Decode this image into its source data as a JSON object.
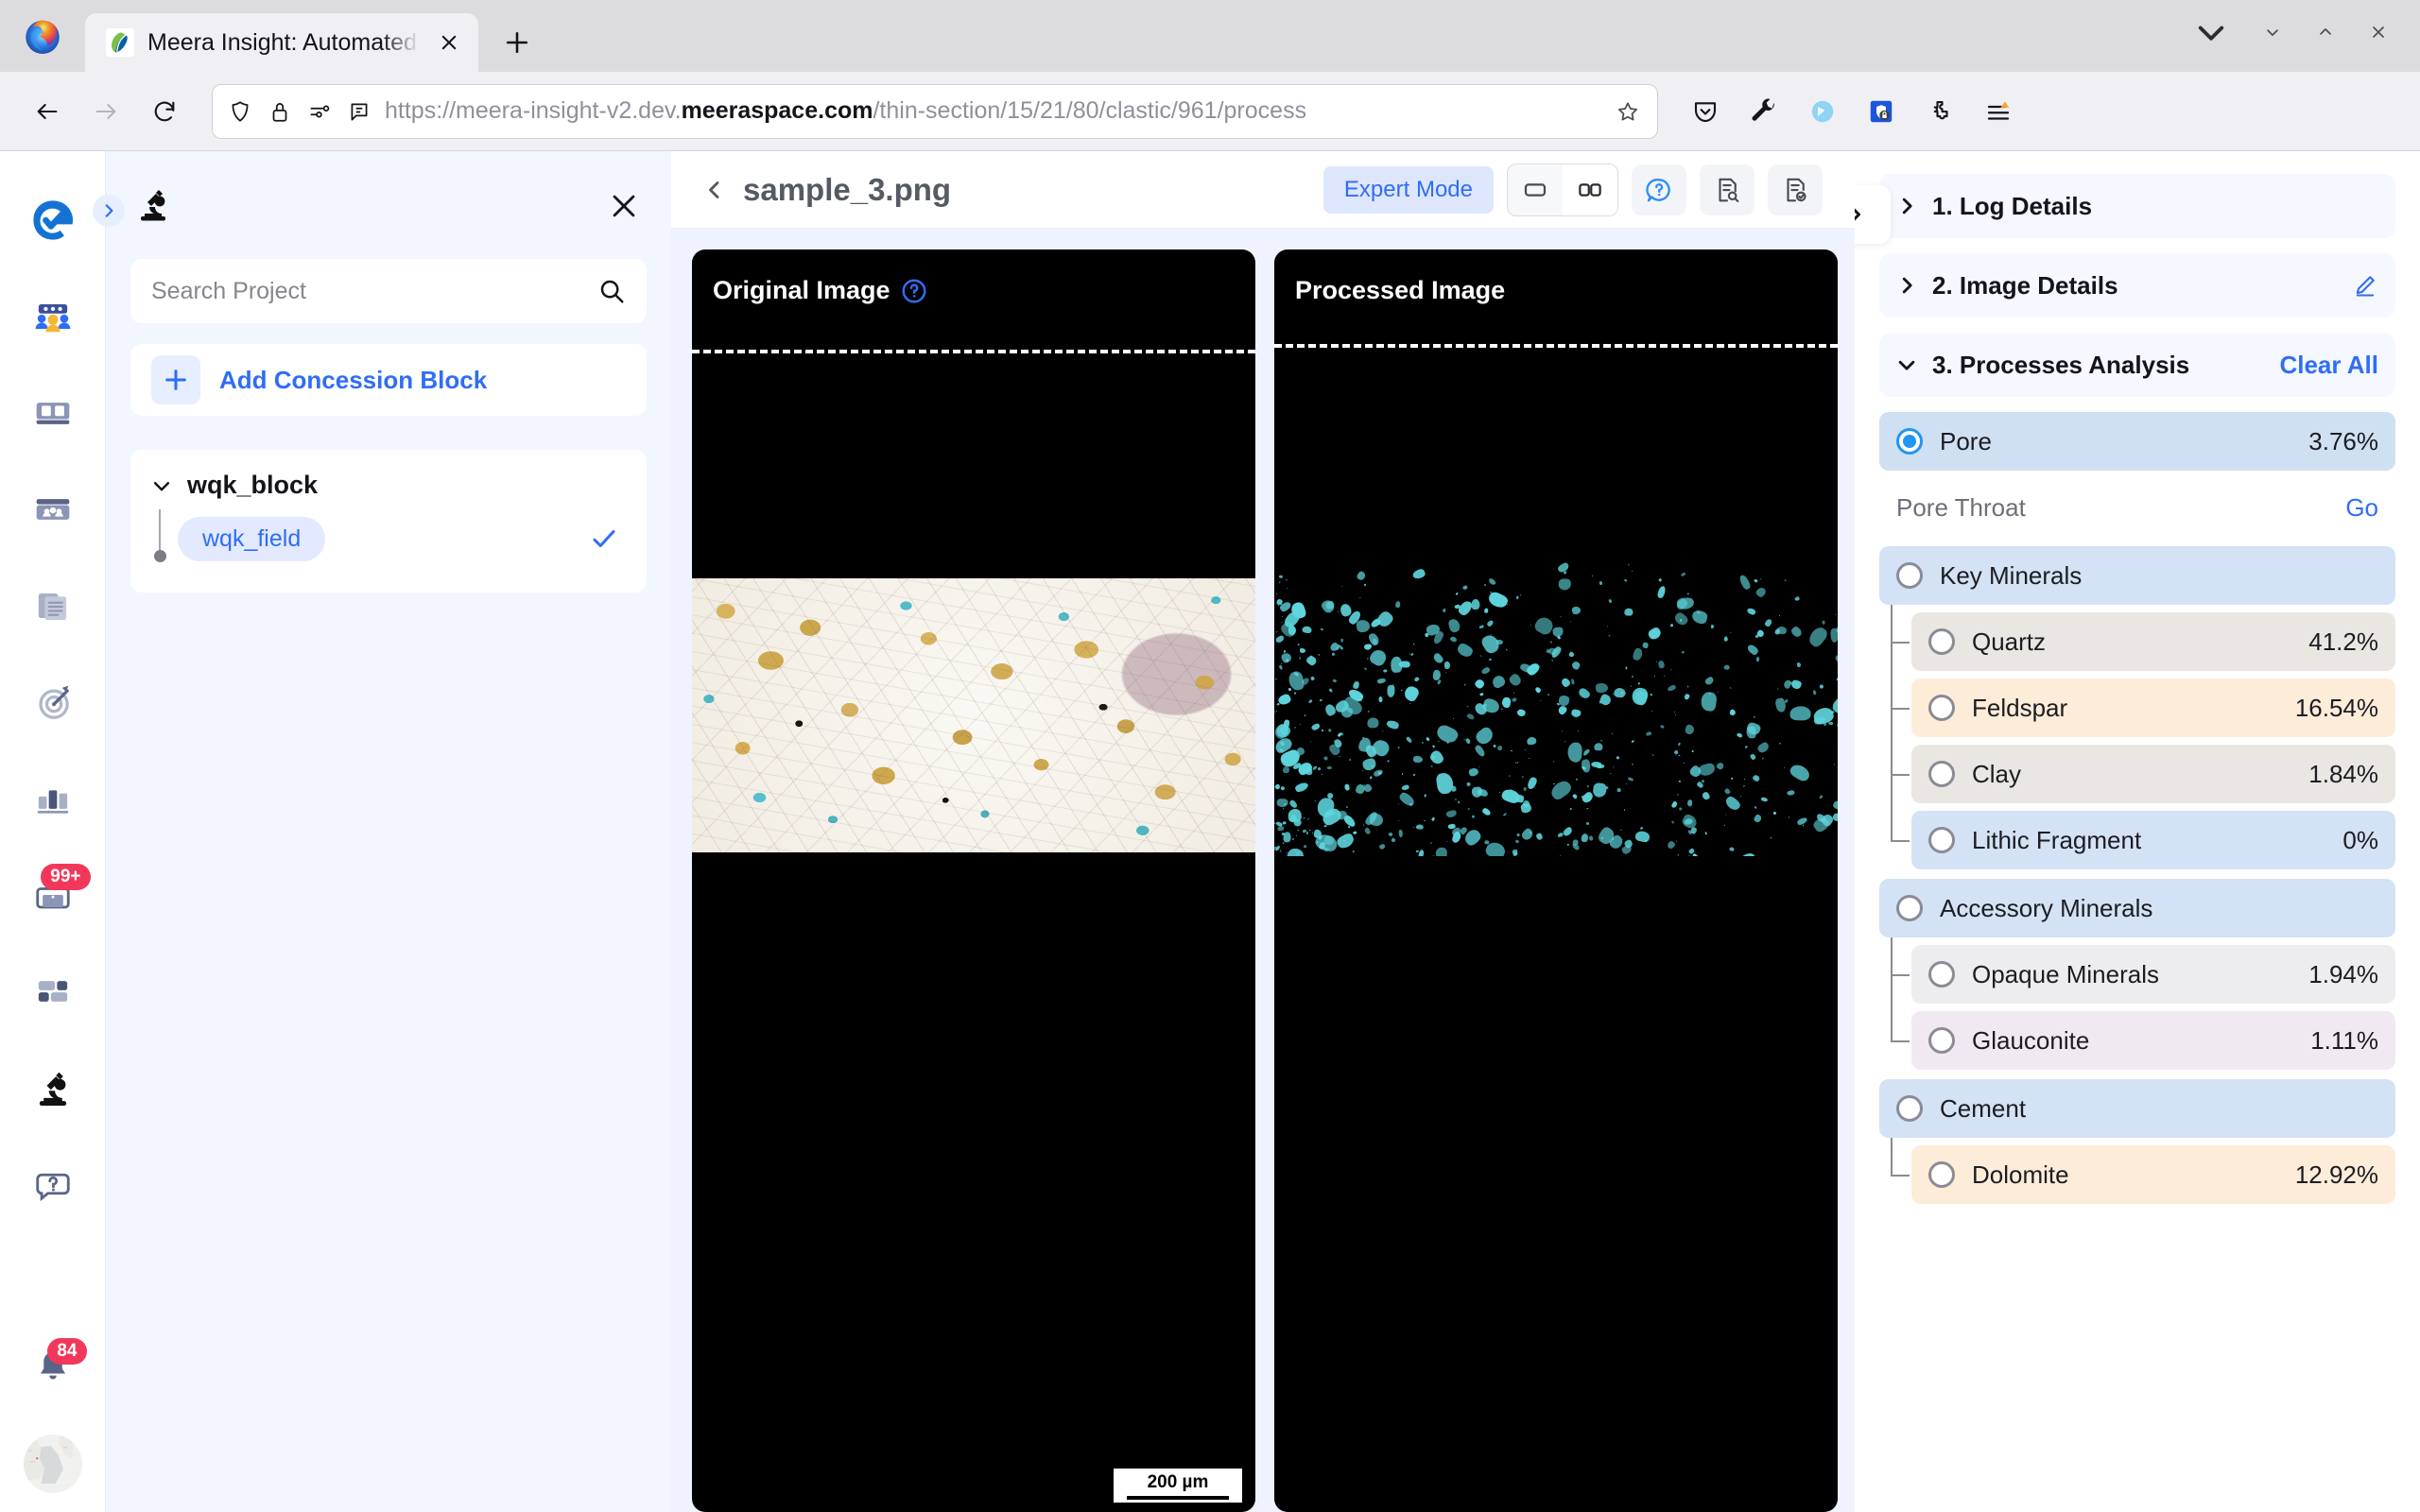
{
  "browser": {
    "tab": {
      "title": "Meera Insight: Automated",
      "favicon": "meera-leaf-icon"
    },
    "newtab_label": "+",
    "url_display_prefix": "https://meera-insight-v2.dev.",
    "url_display_domain": "meeraspace.com",
    "url_display_suffix": "/thin-section/15/21/80/clastic/961/process",
    "toolbar_icons": [
      "pocket-icon",
      "wrench-icon",
      "sync-circle-icon",
      "shield-lock-icon",
      "extensions-puzzle-icon",
      "app-menu-icon"
    ],
    "nav_icons": [
      "back-arrow-icon",
      "forward-arrow-icon",
      "reload-icon"
    ],
    "urlbar_icons": [
      "shield-icon",
      "lock-icon",
      "permissions-icon",
      "reader-chat-icon"
    ],
    "window_controls": [
      "chevron-down-icon",
      "minimize-icon",
      "maximize-icon",
      "close-icon"
    ]
  },
  "rail": {
    "items": [
      {
        "name": "meera-logo-icon",
        "label": "Meera"
      },
      {
        "name": "team-icon",
        "label": "Team"
      },
      {
        "name": "dashboard-icon",
        "label": "Dashboard"
      },
      {
        "name": "group-panel-icon",
        "label": "Groups"
      },
      {
        "name": "documents-icon",
        "label": "Documents"
      },
      {
        "name": "target-icon",
        "label": "Targets"
      },
      {
        "name": "bar-chart-icon",
        "label": "Analytics"
      },
      {
        "name": "briefcase-icon",
        "label": "Cases",
        "badge": "99+"
      },
      {
        "name": "apps-grid-icon",
        "label": "Apps"
      },
      {
        "name": "microscope-icon",
        "label": "Thin Section"
      },
      {
        "name": "help-question-icon",
        "label": "Help"
      }
    ],
    "notification_badge": "84",
    "notification_icon": "bell-icon",
    "avatar": "map-avatar"
  },
  "project_panel": {
    "header_icon": "microscope-icon",
    "close_icon": "close-icon",
    "search": {
      "placeholder": "Search Project",
      "value": "",
      "icon": "search-icon"
    },
    "add_block_label": "Add Concession Block",
    "add_block_icon": "plus-icon",
    "tree": {
      "block_name": "wqk_block",
      "expanded": true,
      "children": [
        {
          "label": "wqk_field",
          "selected": true,
          "check_icon": "check-icon"
        }
      ]
    }
  },
  "main": {
    "back_icon": "chevron-left-icon",
    "file_title": "sample_3.png",
    "expert_mode_label": "Expert Mode",
    "view_single_icon": "single-pane-icon",
    "view_split_icon": "split-pane-icon",
    "view_active": "split",
    "help_icon": "help-circle-icon",
    "report_search_icon": "report-search-icon",
    "report_check_icon": "report-approve-icon",
    "panels": [
      {
        "label": "Original Image",
        "info_icon": "question-circle-icon",
        "scale_bar": "200 µm"
      },
      {
        "label": "Processed Image",
        "info_icon": null
      }
    ]
  },
  "right_panel": {
    "collapse_icon": "chevron-right-icon",
    "sections": [
      {
        "index": "1.",
        "title": "1. Log Details",
        "expanded": false,
        "chev": "chevron-right-icon"
      },
      {
        "index": "2.",
        "title": "2. Image Details",
        "expanded": false,
        "chev": "chevron-right-icon",
        "action_icon": "edit-pencil-icon"
      },
      {
        "index": "3.",
        "title": "3. Processes Analysis",
        "expanded": true,
        "chev": "chevron-down-icon",
        "action_label": "Clear All"
      }
    ],
    "pore": {
      "label": "Pore",
      "value": "3.76%",
      "selected": true
    },
    "pore_throat": {
      "label": "Pore Throat",
      "action": "Go"
    },
    "groups": [
      {
        "label": "Key Minerals",
        "selected": false,
        "items": [
          {
            "label": "Quartz",
            "value": "41.2%",
            "color": "#eae7e3"
          },
          {
            "label": "Feldspar",
            "value": "16.54%",
            "color": "#fdecd8"
          },
          {
            "label": "Clay",
            "value": "1.84%",
            "color": "#eae7e3"
          },
          {
            "label": "Lithic Fragment",
            "value": "0%",
            "color": "#d3e2f5"
          }
        ]
      },
      {
        "label": "Accessory Minerals",
        "selected": false,
        "items": [
          {
            "label": "Opaque Minerals",
            "value": "1.94%",
            "color": "#ededef"
          },
          {
            "label": "Glauconite",
            "value": "1.11%",
            "color": "#f1e9f1"
          }
        ]
      },
      {
        "label": "Cement",
        "selected": false,
        "items": [
          {
            "label": "Dolomite",
            "value": "12.92%",
            "color": "#fdecd8"
          }
        ]
      }
    ]
  },
  "colors": {
    "accent_blue": "#2f6df6",
    "panel_bg": "#eef3ff",
    "group_header": "#d3e2f5",
    "selected_row": "#cfe0f2",
    "badge_red": "#f2385a",
    "pore_cyan": "#5fd6de"
  }
}
